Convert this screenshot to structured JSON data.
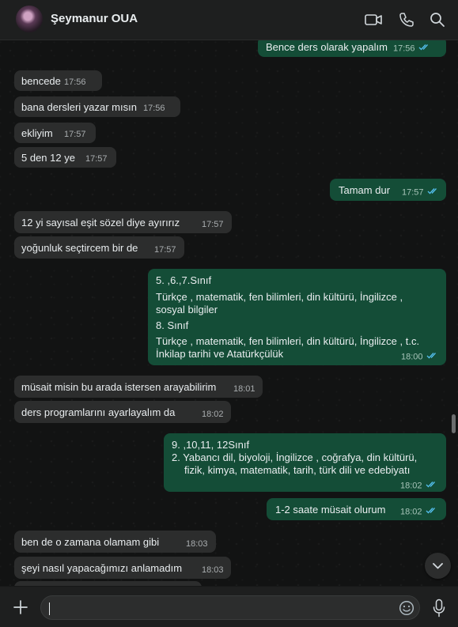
{
  "header": {
    "contact_name": "Şeymanur OUA",
    "icons": [
      "video-call-icon",
      "voice-call-icon",
      "search-icon"
    ]
  },
  "messages": [
    {
      "dir": "out",
      "text": "Bence ders olarak yapalım",
      "time": "17:56",
      "read": true
    },
    {
      "dir": "in",
      "text": "bencede",
      "time": "17:56"
    },
    {
      "dir": "in",
      "text": "bana dersleri yazar mısın",
      "time": "17:56"
    },
    {
      "dir": "in",
      "text": "ekliyim",
      "time": "17:57"
    },
    {
      "dir": "in",
      "text": "5 den 12 ye",
      "time": "17:57"
    },
    {
      "dir": "out",
      "text": "Tamam dur",
      "time": "17:57",
      "read": true
    },
    {
      "dir": "in",
      "text": "12 yi sayısal eşit sözel diye ayırırız",
      "time": "17:57"
    },
    {
      "dir": "in",
      "text": "yoğunluk seçtircem bir de",
      "time": "17:57"
    },
    {
      "dir": "out",
      "lines": [
        "5. ,6.,7.Sınıf",
        "Türkçe , matematik, fen bilimleri, din kültürü, İngilizce ,",
        "sosyal bilgiler",
        "8. Sınıf",
        "Türkçe , matematik, fen bilimleri, din kültürü, İngilizce , t.c.",
        "İnkilap tarihi ve Atatürkçülük"
      ],
      "time": "18:00",
      "read": true
    },
    {
      "dir": "in",
      "text": "müsait misin bu arada istersen arayabilirim",
      "time": "18:01"
    },
    {
      "dir": "in",
      "text": "ders programlarını ayarlayalım da",
      "time": "18:02"
    },
    {
      "dir": "out",
      "lines": [
        "9. ,10,11, 12Sınıf",
        "2. Yabancı dil, biyoloji, İngilizce , coğrafya, din kültürü,",
        "fizik, kimya, matematik, tarih, türk dili ve edebiyatı"
      ],
      "time": "18:02",
      "read": true
    },
    {
      "dir": "out",
      "text": "1-2 saate müsait olurum",
      "time": "18:02",
      "read": true
    },
    {
      "dir": "in",
      "text": "ben de o zamana olamam gibi",
      "time": "18:03"
    },
    {
      "dir": "in",
      "text": "şeyi nasıl yapacağımızı anlamadım",
      "time": "18:03"
    }
  ],
  "composer": {
    "value": ""
  },
  "colors": {
    "outgoing_bubble": "#144d37",
    "incoming_bubble": "#2c2d2d",
    "read_ticks": "#53bdeb"
  }
}
